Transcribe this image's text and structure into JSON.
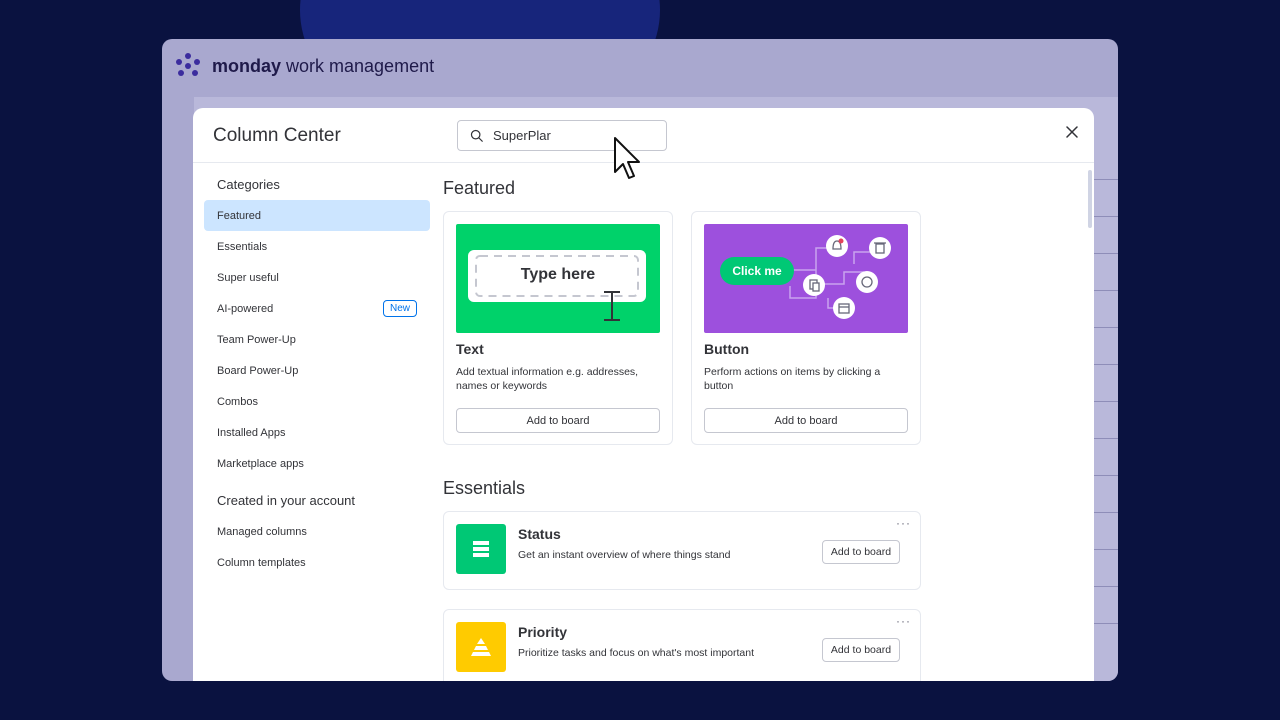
{
  "brand": {
    "name_bold": "monday",
    "name_rest": " work management"
  },
  "modal": {
    "title": "Column Center",
    "search": {
      "value": "SuperPlar",
      "placeholder": "Search"
    }
  },
  "sidebar": {
    "heading_categories": "Categories",
    "items": [
      {
        "label": "Featured",
        "active": true
      },
      {
        "label": "Essentials"
      },
      {
        "label": "Super useful"
      },
      {
        "label": "AI-powered",
        "badge": "New"
      },
      {
        "label": "Team Power-Up"
      },
      {
        "label": "Board Power-Up"
      },
      {
        "label": "Combos"
      },
      {
        "label": "Installed Apps"
      },
      {
        "label": "Marketplace apps"
      }
    ],
    "heading_account": "Created in your account",
    "account_items": [
      {
        "label": "Managed columns"
      },
      {
        "label": "Column templates"
      }
    ]
  },
  "featured": {
    "title": "Featured",
    "cards": [
      {
        "name": "Text",
        "description": "Add textual information e.g. addresses, names or keywords",
        "button": "Add to board",
        "image_text": "Type here",
        "image_color": "#00d26a"
      },
      {
        "name": "Button",
        "description": "Perform actions on items by clicking a button",
        "button": "Add to board",
        "image_text": "Click me",
        "image_color": "#9d50dd"
      }
    ]
  },
  "essentials": {
    "title": "Essentials",
    "cards": [
      {
        "name": "Status",
        "description": "Get an instant overview of where things stand",
        "button": "Add to board",
        "icon": "status-icon",
        "color": "#00c875"
      },
      {
        "name": "Priority",
        "description": "Prioritize tasks and focus on what's most important",
        "button": "Add to board",
        "icon": "priority-icon",
        "color": "#ffcb00"
      }
    ],
    "more_label": "···"
  }
}
